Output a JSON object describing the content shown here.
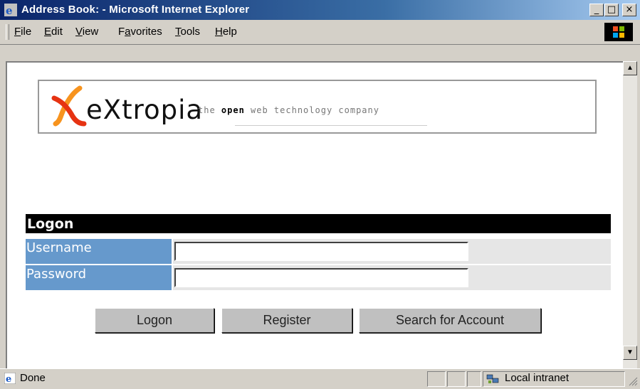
{
  "window": {
    "title": "Address Book: - Microsoft Internet Explorer",
    "controls": [
      "minimize-icon",
      "maximize-icon",
      "close-icon"
    ]
  },
  "menu": {
    "items": [
      {
        "accel": "F",
        "rest": "ile"
      },
      {
        "accel": "E",
        "rest": "dit"
      },
      {
        "accel": "V",
        "rest": "iew"
      },
      {
        "pre": "F",
        "accel": "a",
        "rest": "vorites"
      },
      {
        "accel": "T",
        "rest": "ools"
      },
      {
        "accel": "H",
        "rest": "elp"
      }
    ]
  },
  "logo": {
    "word": "eXtropia",
    "tagline_pre": "the ",
    "tagline_bold": "open",
    "tagline_post": " web technology company"
  },
  "form": {
    "header": "Logon",
    "username_label": "Username",
    "username_value": "",
    "password_label": "Password",
    "password_value": ""
  },
  "buttons": {
    "logon": "Logon",
    "register": "Register",
    "search": "Search for Account"
  },
  "status": {
    "text": "Done",
    "zone": "Local intranet"
  },
  "colors": {
    "titlebar": "#0a246a",
    "label_bg": "#6699cc",
    "header_bg": "#000000"
  }
}
